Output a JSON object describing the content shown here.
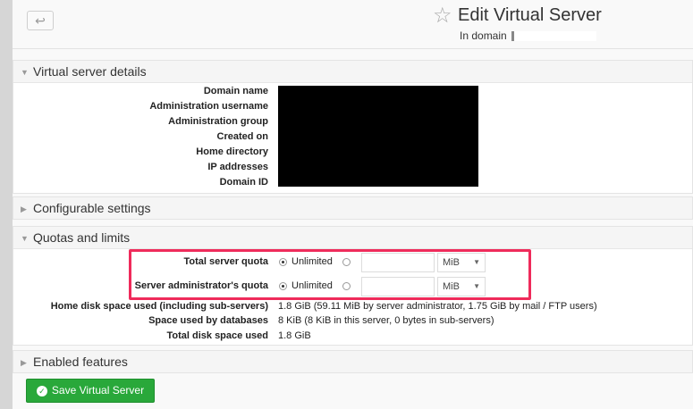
{
  "header": {
    "title": "Edit Virtual Server",
    "subtitle": "In domain",
    "back_icon": "↩",
    "star_icon": "☆"
  },
  "sections": {
    "details": {
      "title": "Virtual server details",
      "labels": [
        "Domain name",
        "Administration username",
        "Administration group",
        "Created on",
        "Home directory",
        "IP addresses",
        "Domain ID"
      ]
    },
    "configurable": {
      "title": "Configurable settings"
    },
    "quotas": {
      "title": "Quotas and limits",
      "total_quota_label": "Total server quota",
      "admin_quota_label": "Server administrator's quota",
      "unlimited_label": "Unlimited",
      "unit": "MiB",
      "home_disk_label": "Home disk space used (including sub-servers)",
      "home_disk_value": "1.8 GiB (59.11 MiB by server administrator, 1.75 GiB by mail / FTP users)",
      "db_space_label": "Space used by databases",
      "db_space_value": "8 KiB (8 KiB in this server, 0 bytes in sub-servers)",
      "total_disk_label": "Total disk space used",
      "total_disk_value": "1.8 GiB"
    },
    "features": {
      "title": "Enabled features"
    }
  },
  "buttons": {
    "save": "Save Virtual Server"
  },
  "colors": {
    "save_green": "#29a83a",
    "highlight": "#ef2b5b"
  }
}
